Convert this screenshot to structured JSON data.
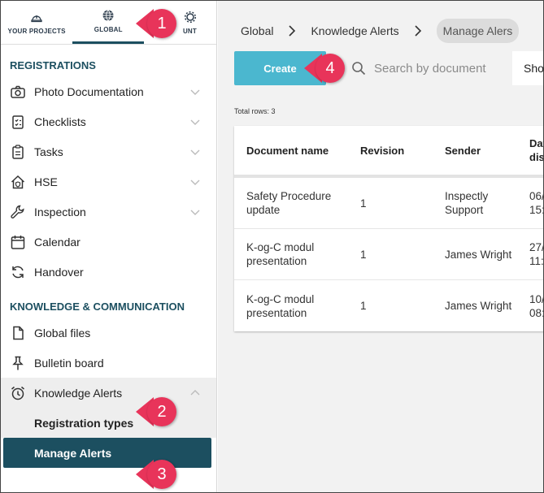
{
  "top_tabs": [
    {
      "label": "YOUR PROJECTS",
      "icon": "hardhat-icon"
    },
    {
      "label": "GLOBAL",
      "icon": "globe-icon"
    },
    {
      "label": "UNT",
      "icon": "gear-icon"
    }
  ],
  "sidebar": {
    "registrations_title": "REGISTRATIONS",
    "registrations": [
      {
        "label": "Photo Documentation",
        "icon": "camera-icon"
      },
      {
        "label": "Checklists",
        "icon": "checklist-icon"
      },
      {
        "label": "Tasks",
        "icon": "clipboard-icon"
      },
      {
        "label": "HSE",
        "icon": "home-shield-icon"
      },
      {
        "label": "Inspection",
        "icon": "wrench-icon"
      },
      {
        "label": "Calendar",
        "icon": "calendar-icon"
      },
      {
        "label": "Handover",
        "icon": "refresh-icon"
      }
    ],
    "knowledge_title": "KNOWLEDGE & COMMUNICATION",
    "knowledge": [
      {
        "label": "Global files",
        "icon": "file-icon"
      },
      {
        "label": "Bulletin board",
        "icon": "pin-icon"
      },
      {
        "label": "Knowledge Alerts",
        "icon": "alarm-clock-icon"
      }
    ],
    "sub_items": [
      {
        "label": "Registration types"
      },
      {
        "label": "Manage Alerts"
      }
    ]
  },
  "breadcrumb": [
    "Global",
    "Knowledge Alerts",
    "Manage Alers"
  ],
  "toolbar": {
    "create_label": "Create",
    "search_placeholder": "Search by document",
    "show_label": "Sho"
  },
  "total_rows": "Total rows: 3",
  "table": {
    "headers": [
      "Document name",
      "Revision",
      "Sender",
      "Dat dis"
    ],
    "rows": [
      {
        "document": "Safety Procedure update",
        "revision": "1",
        "sender": "Inspectly Support",
        "date": "06/ 15:"
      },
      {
        "document": "K-og-C modul presentation",
        "revision": "1",
        "sender": "James Wright",
        "date": "27/ 11:"
      },
      {
        "document": "K-og-C modul presentation",
        "revision": "1",
        "sender": "James Wright",
        "date": "10/ 08:"
      }
    ]
  },
  "callouts": [
    "1",
    "2",
    "3",
    "4"
  ],
  "colors": {
    "brand_dark": "#1c4f60",
    "create_button": "#4bb7cf",
    "callout": "#e8345a"
  }
}
